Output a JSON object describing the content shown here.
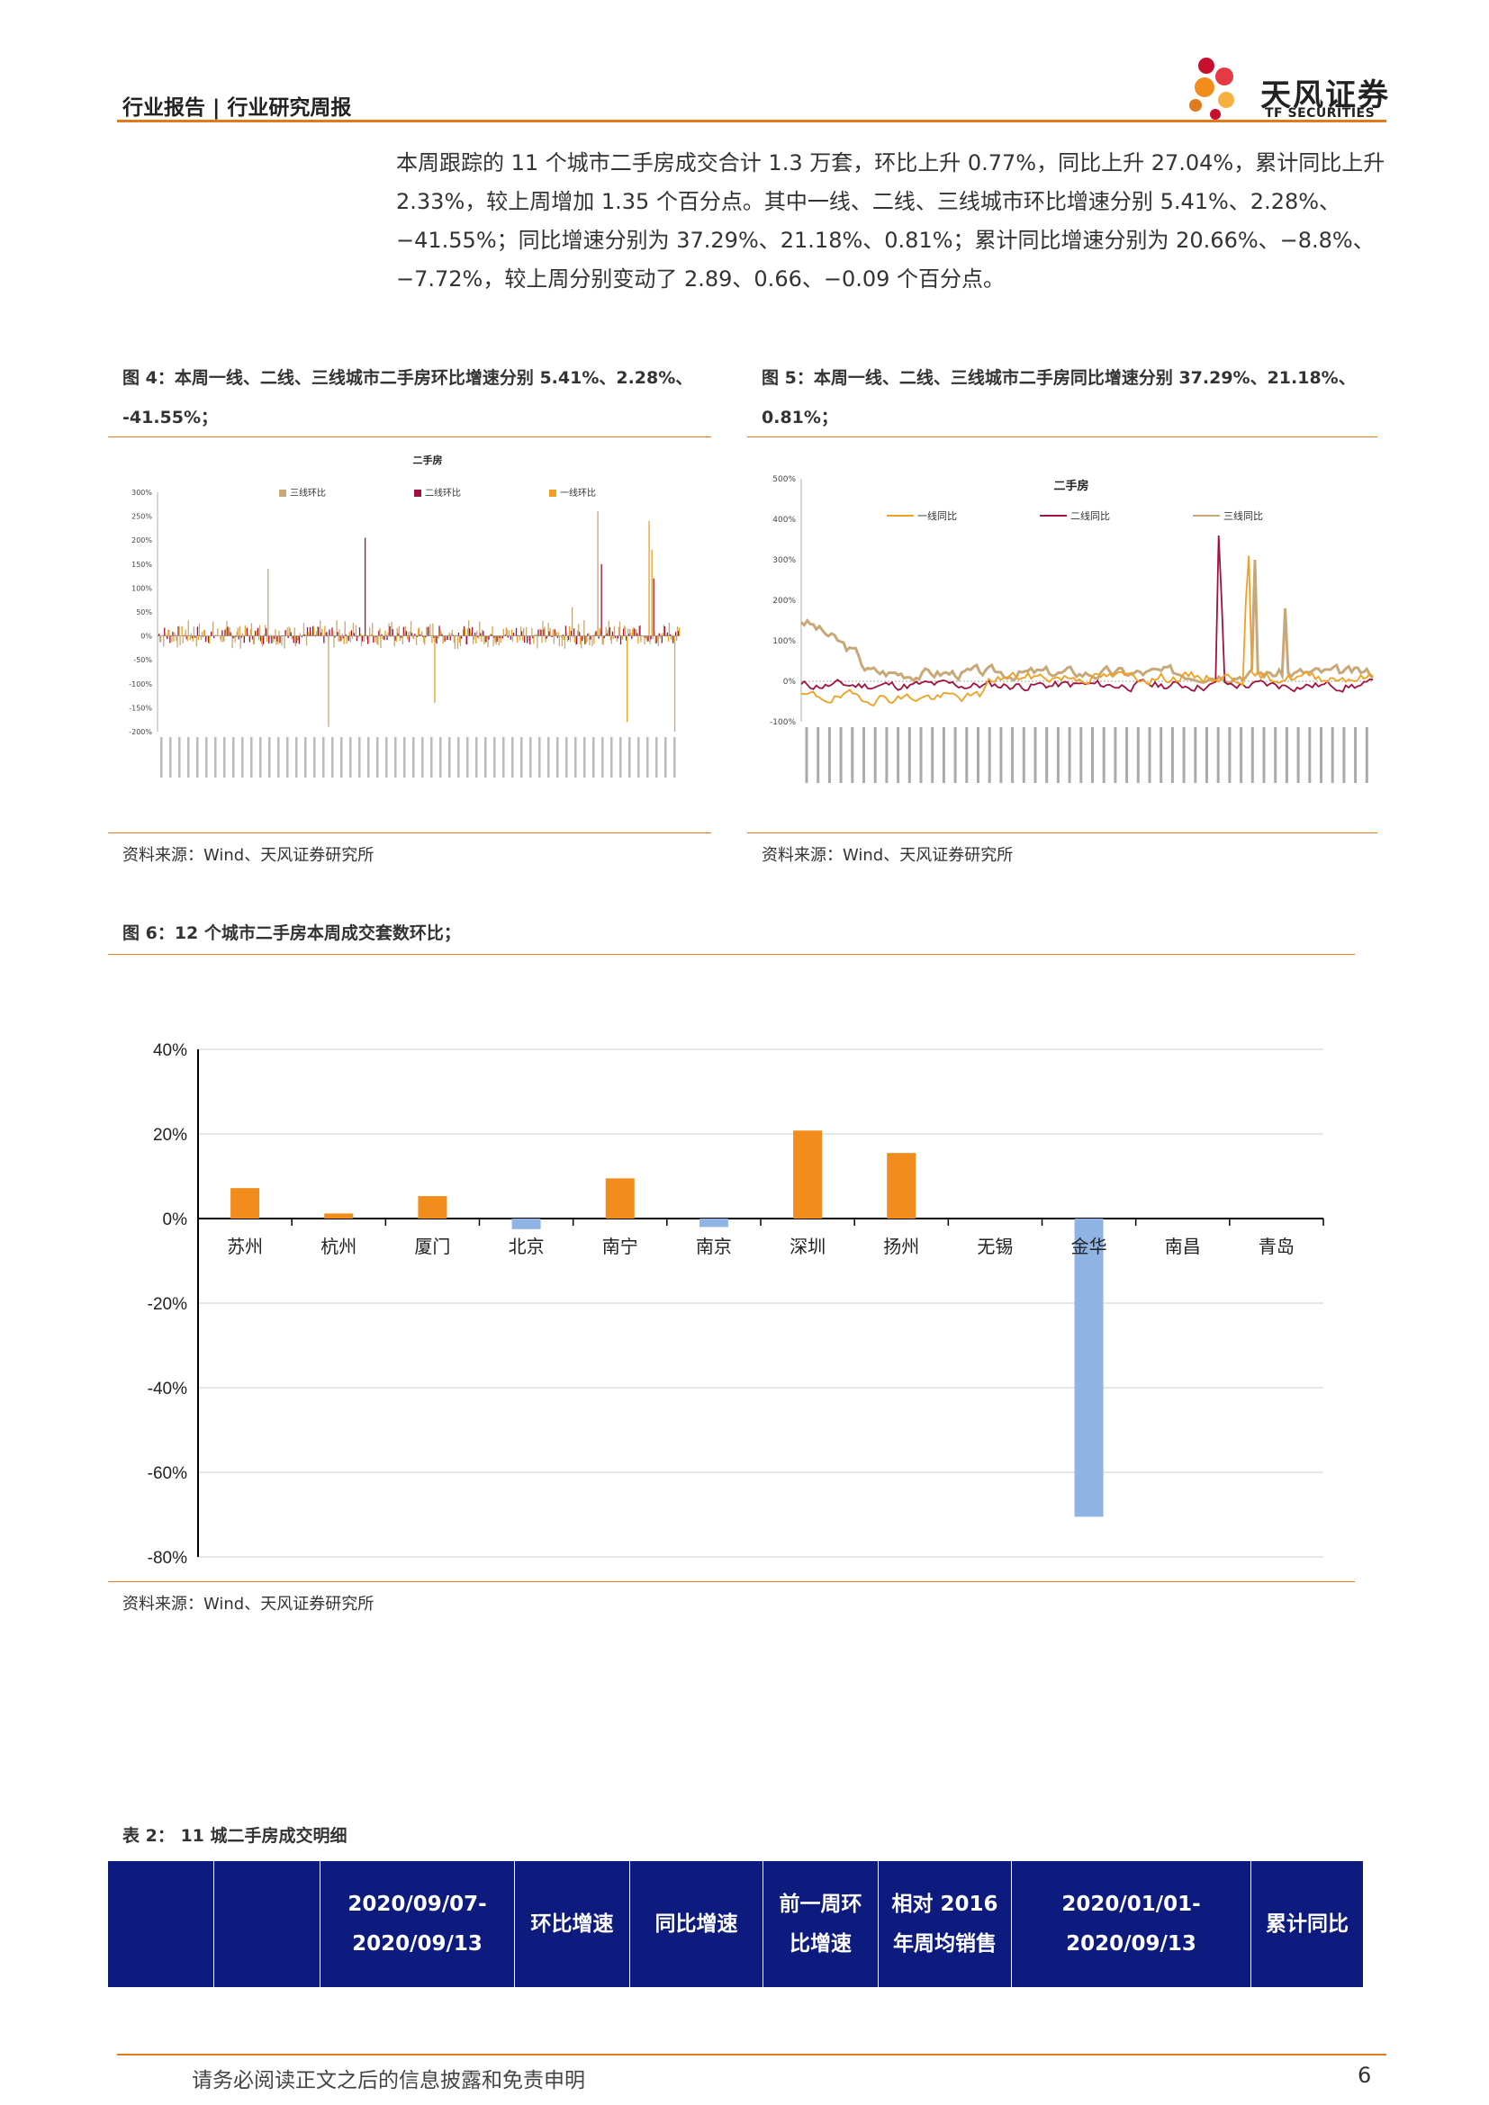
{
  "header": {
    "title": "行业报告 | 行业研究周报",
    "logo_cn": "天风证券",
    "logo_en": "TF SECURITIES"
  },
  "body_paragraph": "本周跟踪的 11 个城市二手房成交合计 1.3 万套，环比上升 0.77%，同比上升 27.04%，累计同比上升 2.33%，较上周增加 1.35 个百分点。其中一线、二线、三线城市环比增速分别 5.41%、2.28%、−41.55%；同比增速分别为 37.29%、21.18%、0.81%；累计同比增速分别为 20.66%、−8.8%、−7.72%，较上周分别变动了 2.89、0.66、−0.09 个百分点。",
  "colors": {
    "accent": "#e07a1e",
    "first_tier": "#f0a020",
    "second_tier": "#a0123c",
    "third_tier": "#c8a878",
    "positive_bar": "#f28c1c",
    "negative_bar": "#8fb4e3",
    "table_bg": "#0d1a7e"
  },
  "figure4": {
    "caption_line1": "图 4：本周一线、二线、三线城市二手房环比增速分别 5.41%、2.28%、",
    "caption_line2": "-41.55%；",
    "source": "资料来源：Wind、天风证券研究所",
    "chart_title": "二手房",
    "legend": [
      "三线环比",
      "二线环比",
      "一线环比"
    ],
    "y_ticks": [
      "300%",
      "250%",
      "200%",
      "150%",
      "100%",
      "50%",
      "0%",
      "-50%",
      "-100%",
      "-150%",
      "-200%"
    ]
  },
  "figure5": {
    "caption_line1": "图 5：本周一线、二线、三线城市二手房同比增速分别 37.29%、21.18%、",
    "caption_line2": "0.81%；",
    "source": "资料来源：Wind、天风证券研究所",
    "chart_title": "二手房",
    "legend": [
      "一线同比",
      "二线同比",
      "三线同比"
    ],
    "y_ticks": [
      "500%",
      "400%",
      "300%",
      "200%",
      "100%",
      "0%",
      "-100%"
    ]
  },
  "figure6": {
    "caption": "图 6：12 个城市二手房本周成交套数环比；",
    "source": "资料来源：Wind、天风证券研究所"
  },
  "chart_data": [
    {
      "type": "bar",
      "categories": [
        "苏州",
        "杭州",
        "厦门",
        "北京",
        "南宁",
        "南京",
        "深圳",
        "扬州",
        "无锡",
        "金华",
        "南昌",
        "青岛"
      ],
      "values": [
        7.2,
        1.2,
        5.3,
        -2.5,
        9.5,
        -2.0,
        20.8,
        15.5,
        0,
        -70.5,
        0,
        0
      ],
      "y_ticks": [
        "40%",
        "20%",
        "0%",
        "-20%",
        "-40%",
        "-60%",
        "-80%"
      ],
      "ylim": [
        -80,
        40
      ],
      "grid": true
    }
  ],
  "table": {
    "caption": "表 2： 11 城二手房成交明细",
    "headers": [
      "",
      "",
      "2020/09/07-2020/09/13",
      "环比增速",
      "同比增速",
      "前一周环比增速",
      "相对 2016 年周均销售",
      "2020/01/01-2020/09/13",
      "累计同比"
    ]
  },
  "footer": {
    "disclaimer": "请务必阅读正文之后的信息披露和免责申明",
    "page": "6"
  }
}
